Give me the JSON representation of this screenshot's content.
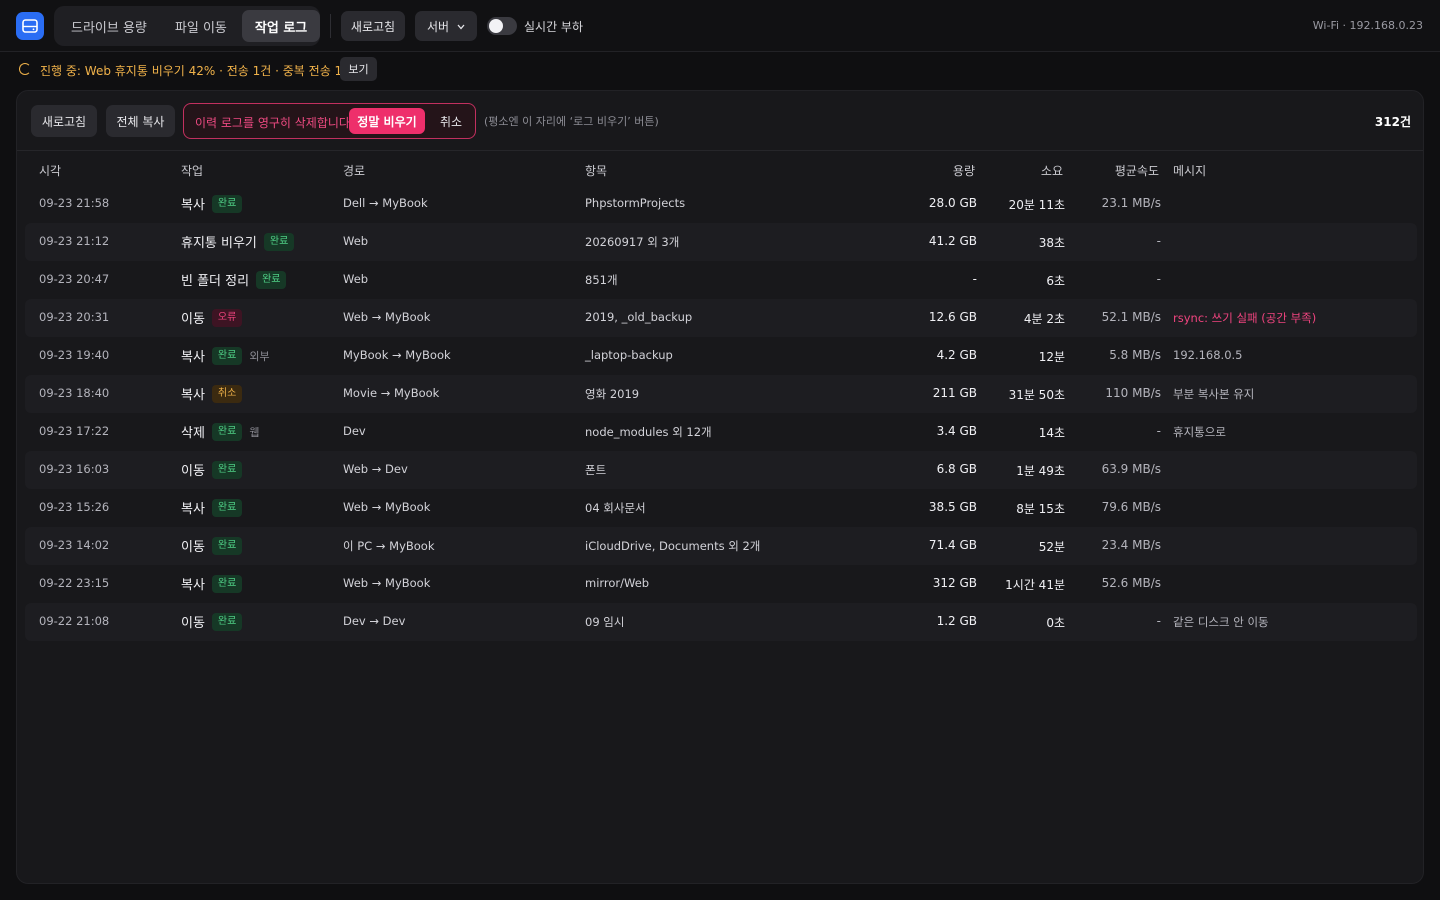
{
  "colors": {
    "accent": "#2a6df4",
    "danger": "#ee2f6b",
    "warning": "#f0b24a",
    "success": "#4fcf86"
  },
  "app": {
    "logo_icon": "drive-icon"
  },
  "tabs": [
    {
      "label": "드라이브 용량",
      "active": false
    },
    {
      "label": "파일 이동",
      "active": false
    },
    {
      "label": "작업 로그",
      "active": true
    }
  ],
  "topbar": {
    "refresh_label": "새로고침",
    "server_label": "서버",
    "server_icon": "chevron-down-icon",
    "live_load_label": "실시간 부하",
    "live_load_on": false,
    "network_status": "Wi-Fi · 192.168.0.23"
  },
  "progress": {
    "text": "진행 중: Web 휴지통 비우기 42% · 전송 1건 · 중복 전송 1건",
    "view_label": "보기"
  },
  "toolbar": {
    "refresh_label": "새로고침",
    "copy_all_label": "전체 복사",
    "confirm_message": "이력 로그를 영구히 삭제합니다",
    "confirm_danger_label": "정말 비우기",
    "confirm_cancel_label": "취소",
    "hint": "(평소엔 이 자리에 ‘로그 비우기’ 버튼)",
    "count": "312건"
  },
  "table": {
    "headers": {
      "time": "시각",
      "op": "작업",
      "path": "경로",
      "item": "항목",
      "size": "용량",
      "duration": "소요",
      "speed": "평균속도",
      "message": "메시지"
    },
    "rows": [
      {
        "time": "09-23 21:58",
        "op": "복사",
        "status": "완료",
        "kind": "ok",
        "extra": "",
        "path": "Dell → MyBook",
        "item": "PhpstormProjects",
        "size": "28.0 GB",
        "duration": "20분 11초",
        "speed": "23.1 MB/s",
        "message": ""
      },
      {
        "time": "09-23 21:12",
        "op": "휴지통 비우기",
        "status": "완료",
        "kind": "ok",
        "extra": "",
        "path": "Web",
        "item": "20260917 외 3개",
        "size": "41.2 GB",
        "duration": "38초",
        "speed": "-",
        "message": ""
      },
      {
        "time": "09-23 20:47",
        "op": "빈 폴더 정리",
        "status": "완료",
        "kind": "ok",
        "extra": "",
        "path": "Web",
        "item": "851개",
        "size": "-",
        "duration": "6초",
        "speed": "-",
        "message": ""
      },
      {
        "time": "09-23 20:31",
        "op": "이동",
        "status": "오류",
        "kind": "err",
        "extra": "",
        "path": "Web → MyBook",
        "item": "2019, _old_backup",
        "size": "12.6 GB",
        "duration": "4분 2초",
        "speed": "52.1 MB/s",
        "message": "rsync: 쓰기 실패 (공간 부족)"
      },
      {
        "time": "09-23 19:40",
        "op": "복사",
        "status": "완료",
        "kind": "ok",
        "extra": "외부",
        "path": "MyBook → MyBook",
        "item": "_laptop-backup",
        "size": "4.2 GB",
        "duration": "12분",
        "speed": "5.8 MB/s",
        "message": "192.168.0.5"
      },
      {
        "time": "09-23 18:40",
        "op": "복사",
        "status": "취소",
        "kind": "cancel",
        "extra": "",
        "path": "Movie → MyBook",
        "item": "영화 2019",
        "size": "211 GB",
        "duration": "31분 50초",
        "speed": "110 MB/s",
        "message": "부분 복사본 유지"
      },
      {
        "time": "09-23 17:22",
        "op": "삭제",
        "status": "완료",
        "kind": "ok",
        "extra": "웹",
        "path": "Dev",
        "item": "node_modules 외 12개",
        "size": "3.4 GB",
        "duration": "14초",
        "speed": "-",
        "message": "휴지통으로"
      },
      {
        "time": "09-23 16:03",
        "op": "이동",
        "status": "완료",
        "kind": "ok",
        "extra": "",
        "path": "Web → Dev",
        "item": "폰트",
        "size": "6.8 GB",
        "duration": "1분 49초",
        "speed": "63.9 MB/s",
        "message": ""
      },
      {
        "time": "09-23 15:26",
        "op": "복사",
        "status": "완료",
        "kind": "ok",
        "extra": "",
        "path": "Web → MyBook",
        "item": "04 회사문서",
        "size": "38.5 GB",
        "duration": "8분 15초",
        "speed": "79.6 MB/s",
        "message": ""
      },
      {
        "time": "09-23 14:02",
        "op": "이동",
        "status": "완료",
        "kind": "ok",
        "extra": "",
        "path": "이 PC → MyBook",
        "item": "iCloudDrive, Documents 외 2개",
        "size": "71.4 GB",
        "duration": "52분",
        "speed": "23.4 MB/s",
        "message": ""
      },
      {
        "time": "09-22 23:15",
        "op": "복사",
        "status": "완료",
        "kind": "ok",
        "extra": "",
        "path": "Web → MyBook",
        "item": "mirror/Web",
        "size": "312 GB",
        "duration": "1시간 41분",
        "speed": "52.6 MB/s",
        "message": ""
      },
      {
        "time": "09-22 21:08",
        "op": "이동",
        "status": "완료",
        "kind": "ok",
        "extra": "",
        "path": "Dev → Dev",
        "item": "09 임시",
        "size": "1.2 GB",
        "duration": "0초",
        "speed": "-",
        "message": "같은 디스크 안 이동"
      }
    ]
  }
}
